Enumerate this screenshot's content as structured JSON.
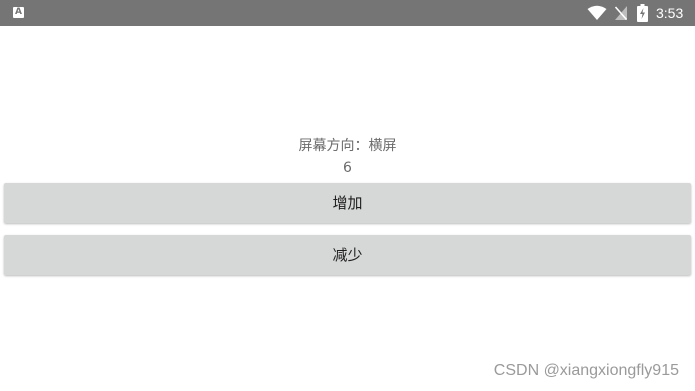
{
  "status_bar": {
    "app_indicator": "A",
    "time": "3:53",
    "icons": [
      "wifi-icon",
      "no-sim-icon",
      "battery-charging-icon"
    ]
  },
  "main": {
    "orientation_label": "屏幕方向：横屏",
    "counter_value": "6",
    "increase_label": "增加",
    "decrease_label": "减少"
  },
  "watermark": "CSDN @xiangxiongfly915",
  "colors": {
    "status_bar_bg": "#757575",
    "button_bg": "#d6d7d7",
    "text_secondary": "#6b6b6b"
  }
}
